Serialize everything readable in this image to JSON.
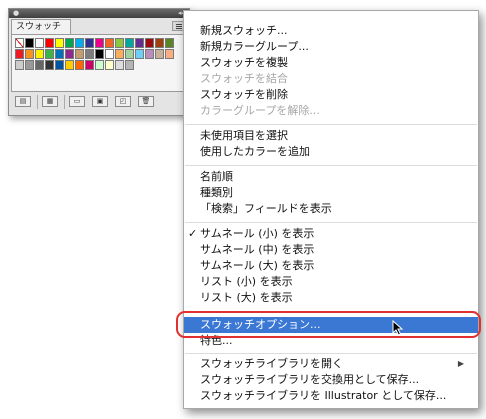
{
  "panel": {
    "tab_label": "スウォッチ",
    "swatches_row1": [
      "#ffffff",
      "#000000",
      "#ffffff",
      "#ff0000",
      "#ffff00",
      "#00a651",
      "#00aeef",
      "#2e3192",
      "#ec008c",
      "#f26522",
      "#8dc63f",
      "#00a99d",
      "#662d91",
      "#9e0b0f",
      "#a0410d",
      "#598527"
    ],
    "swatches_row2": [
      "#ed1c24",
      "#f7941d",
      "#fff200",
      "#39b54a",
      "#0072bc",
      "#92278f",
      "#c69c6d",
      "#7d7d7d",
      "#000000",
      "#ffffff",
      "#fbaf5d",
      "#a3d39c",
      "#6dcff6",
      "#bd8cbf",
      "#c7b299",
      "#f9ad81"
    ],
    "swatches_row3": [
      "#cccccc",
      "#999999",
      "#666666",
      "#333333",
      "#0054a6",
      "#ffcc00",
      "#ff6600",
      "#cc0066",
      "#ccffcc",
      "#ffffcc",
      "#dddddd",
      "#b5b5b5"
    ]
  },
  "menu": {
    "items": [
      {
        "label": "新規スウォッチ...",
        "enabled": true
      },
      {
        "label": "新規カラーグループ...",
        "enabled": true
      },
      {
        "label": "スウォッチを複製",
        "enabled": true
      },
      {
        "label": "スウォッチを結合",
        "enabled": false
      },
      {
        "label": "スウォッチを削除",
        "enabled": true
      },
      {
        "label": "カラーグループを解除...",
        "enabled": false
      },
      {
        "label": "未使用項目を選択",
        "enabled": true
      },
      {
        "label": "使用したカラーを追加",
        "enabled": true
      },
      {
        "label": "名前順",
        "enabled": true
      },
      {
        "label": "種類別",
        "enabled": true
      },
      {
        "label": "「検索」フィールドを表示",
        "enabled": true
      },
      {
        "label": "サムネール (小) を表示",
        "enabled": true,
        "checked": true
      },
      {
        "label": "サムネール (中) を表示",
        "enabled": true
      },
      {
        "label": "サムネール (大) を表示",
        "enabled": true
      },
      {
        "label": "リスト (小) を表示",
        "enabled": true
      },
      {
        "label": "リスト (大) を表示",
        "enabled": true
      },
      {
        "label": "スウォッチオプション...",
        "enabled": true,
        "highlighted": true
      },
      {
        "label": "特色...",
        "enabled": true
      },
      {
        "label": "スウォッチライブラリを開く",
        "enabled": true,
        "submenu": true
      },
      {
        "label": "スウォッチライブラリを交換用として保存...",
        "enabled": true
      },
      {
        "label": "スウォッチライブラリを Illustrator として保存...",
        "enabled": true
      }
    ]
  },
  "colors": {
    "highlight": "#3b78d4",
    "annotation_ring": "#e03030"
  }
}
